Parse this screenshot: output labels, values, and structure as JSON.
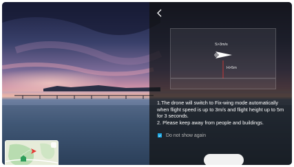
{
  "camera": {
    "scene": "sunset-over-lake-with-pier"
  },
  "overlay": {
    "back_icon": "chevron-left-icon",
    "diagram": {
      "speed_label": "S>3m/s",
      "height_label": "H>5m",
      "plane_icon": "fixed-wing-plane-icon"
    },
    "message_line1": "1.The drone will switch to Fix-wing mode automatically when flight speed is up to 3m/s and flight height up to 5m for 3 seconds.",
    "message_line2": "2. Please keep away from people and buildings.",
    "checkbox": {
      "label": "Do not show again",
      "checked": true
    },
    "confirm_button": {
      "label": ""
    }
  },
  "minimap": {
    "toggle_icon": "expand-map-icon",
    "drone_icon": "drone-arrow-icon",
    "home_icon": "home-point-icon"
  },
  "colors": {
    "accent": "#1ea9e6",
    "drone_marker": "#e53935",
    "home_marker": "#2e9d5a",
    "overlay": "#121212"
  }
}
